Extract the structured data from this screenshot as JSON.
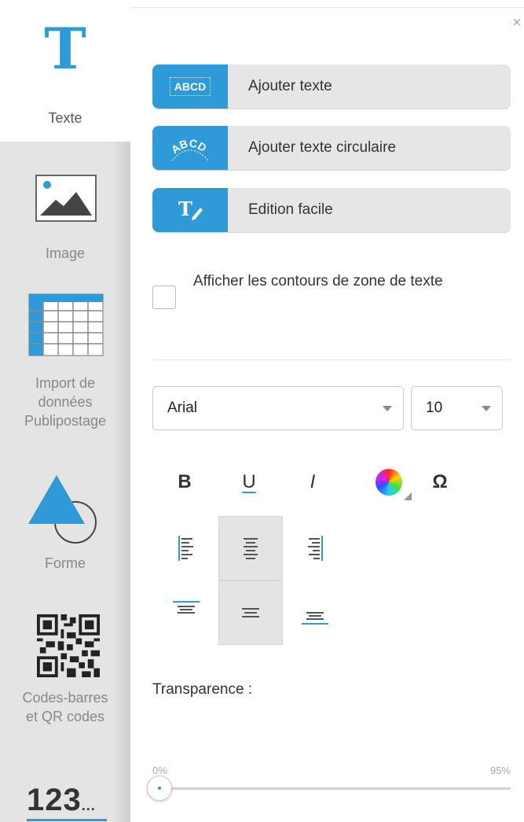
{
  "sidebar": {
    "items": [
      {
        "label": "Texte",
        "icon": "text-t-icon",
        "active": true
      },
      {
        "label": "Image",
        "icon": "image-icon"
      },
      {
        "label": "Import de\ndonnées\nPublipostage",
        "icon": "table-grid-icon"
      },
      {
        "label": "Forme",
        "icon": "shape-icon"
      },
      {
        "label": "Codes-barres\net QR codes",
        "icon": "qr-code-icon"
      },
      {
        "label": "123...",
        "icon": "numbering-icon"
      }
    ],
    "text_icon_glyph": "T",
    "numbers_main": "123",
    "numbers_suffix": "..."
  },
  "panel": {
    "close_glyph": "×",
    "buttons": {
      "add_text": {
        "label": "Ajouter texte",
        "icon_text": "ABCD"
      },
      "add_circular": {
        "label": "Ajouter texte circulaire",
        "icon_text": "ABCD"
      },
      "easy_edit": {
        "label": "Edition facile"
      }
    },
    "show_outlines": {
      "label": "Afficher les contours de zone de texte",
      "checked": false
    },
    "font": {
      "value": "Arial"
    },
    "size": {
      "value": "10"
    },
    "format": {
      "bold": "B",
      "underline": "U",
      "italic": "I",
      "special_char": "Ω"
    },
    "transparency": {
      "label": "Transparence :",
      "min_label": "0%",
      "max_label": "95%",
      "value": 0
    }
  },
  "colors": {
    "accent": "#2e9ad7",
    "sidebar_bg": "#e4e4e4",
    "button_bg": "#e6e6e6"
  }
}
